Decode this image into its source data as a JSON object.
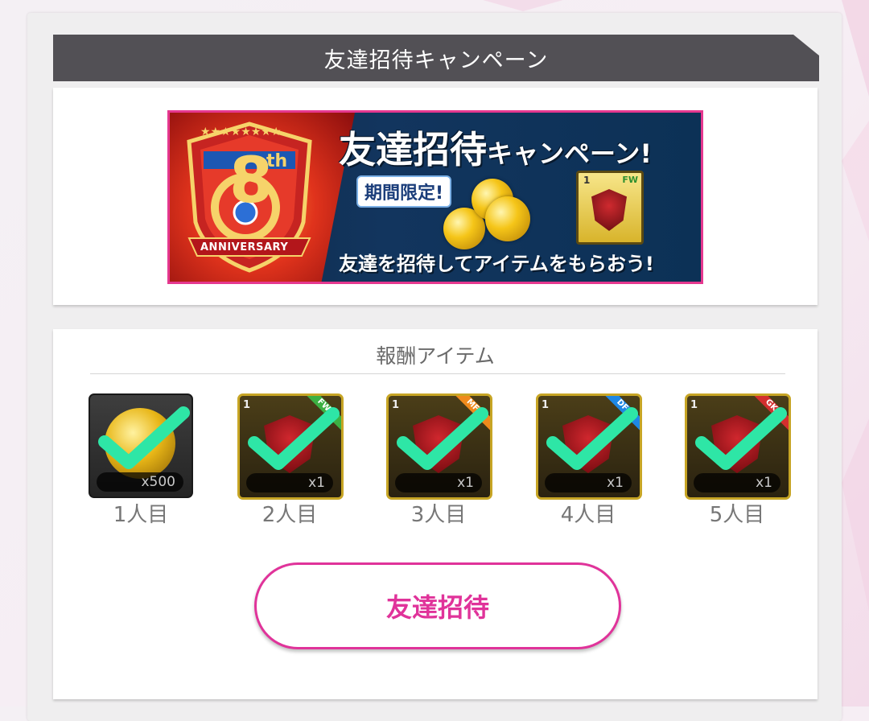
{
  "header": {
    "title": "友達招待キャンペーン"
  },
  "banner": {
    "title_big": "友達招待",
    "title_small": "キャンペーン!",
    "bubble": "期間限定!",
    "subtitle": "友達を招待してアイテムをもらおう!",
    "badge_number": "8",
    "badge_suffix": "th",
    "badge_text": "ANNIVERSARY",
    "card_tag": "1",
    "card_pos": "FW"
  },
  "rewards": {
    "title": "報酬アイテム",
    "items": [
      {
        "label": "1人目",
        "qty": "x500",
        "kind": "coin",
        "claimed": true
      },
      {
        "label": "2人目",
        "qty": "x1",
        "kind": "player-card",
        "tag": "1",
        "pos": "FW",
        "pos_color": "#3cb043",
        "claimed": true
      },
      {
        "label": "3人目",
        "qty": "x1",
        "kind": "player-card",
        "tag": "1",
        "pos": "MF",
        "pos_color": "#f08a1c",
        "claimed": true
      },
      {
        "label": "4人目",
        "qty": "x1",
        "kind": "player-card",
        "tag": "1",
        "pos": "DF",
        "pos_color": "#1e88e5",
        "claimed": true
      },
      {
        "label": "5人目",
        "qty": "x1",
        "kind": "player-card",
        "tag": "1",
        "pos": "GK",
        "pos_color": "#d32f2f",
        "claimed": true
      }
    ]
  },
  "invite_button": {
    "label": "友達招待"
  },
  "colors": {
    "accent": "#e0339a",
    "header_bg": "#525055",
    "check": "#2ee6a6"
  }
}
